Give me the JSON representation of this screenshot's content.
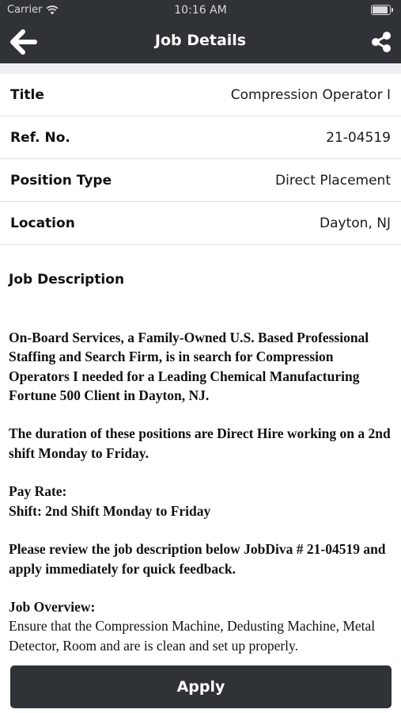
{
  "status_bar": {
    "carrier": "Carrier",
    "time": "10:16 AM"
  },
  "nav": {
    "title": "Job Details",
    "back_icon": "arrow-left-icon",
    "share_icon": "share-icon",
    "background_color": "#2f3236"
  },
  "details": [
    {
      "label": "Title",
      "value": "Compression Operator I"
    },
    {
      "label": "Ref. No.",
      "value": "21-04519"
    },
    {
      "label": "Position Type",
      "value": "Direct Placement"
    },
    {
      "label": "Location",
      "value": "Dayton, NJ"
    }
  ],
  "description": {
    "heading": "Job Description",
    "intro": "On-Board Services, a Family-Owned U.S. Based Professional Staffing and Search Firm, is in search for Compression Operators I needed for a Leading Chemical Manufacturing Fortune 500 Client in Dayton, NJ.",
    "duration": "The duration of these positions are Direct Hire working on a 2nd shift Monday to Friday.",
    "pay_rate": "Pay Rate:",
    "shift": "Shift: 2nd Shift Monday to Friday",
    "review": "Please review the job description below JobDiva # 21-04519  and apply immediately for quick feedback.",
    "overview_heading": "Job Overview:",
    "overview_text": "Ensure that the Compression Machine, Dedusting Machine, Metal Detector, Room and are is clean and set up properly."
  },
  "apply_button": {
    "label": "Apply"
  }
}
